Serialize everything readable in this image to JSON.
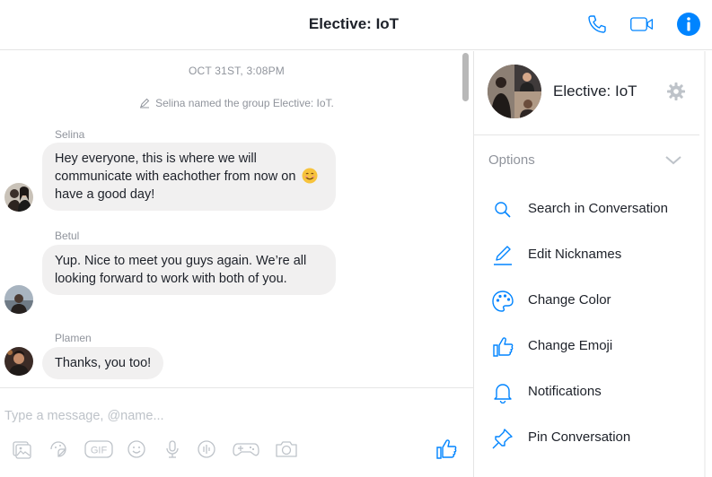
{
  "header": {
    "title": "Elective: IoT",
    "icons": [
      "phone-icon",
      "video-camera-icon",
      "info-icon"
    ],
    "accent_color": "#0084ff"
  },
  "chat": {
    "timestamp": "OCT 31ST, 3:08PM",
    "system_message": "Selina named the group Elective: IoT.",
    "messages": [
      {
        "sender": "Selina",
        "text": "Hey everyone, this is where we will communicate with eachother from now on",
        "text_after_emoji": "have a good day!",
        "emoji": "smiling-face-emoji"
      },
      {
        "sender": "Betul",
        "text": "Yup. Nice to meet you guys again. We’re all looking forward to work with both of you."
      },
      {
        "sender": "Plamen",
        "text": "Thanks, you too!"
      }
    ],
    "bubble_color": "#f1f0f0"
  },
  "composer": {
    "placeholder": "Type a message, @name...",
    "tools": [
      "image-icon",
      "sticker-icon",
      "gif-icon",
      "emoji-icon",
      "microphone-icon",
      "audio-clip-icon",
      "game-controller-icon",
      "camera-icon"
    ],
    "send_icon": "thumbs-up-icon"
  },
  "sidebar": {
    "group_name": "Elective: IoT",
    "options_label": "Options",
    "items": [
      {
        "label": "Search in Conversation",
        "icon": "search-icon"
      },
      {
        "label": "Edit Nicknames",
        "icon": "pencil-icon"
      },
      {
        "label": "Change Color",
        "icon": "palette-icon"
      },
      {
        "label": "Change Emoji",
        "icon": "thumbs-up-icon"
      },
      {
        "label": "Notifications",
        "icon": "bell-icon"
      },
      {
        "label": "Pin Conversation",
        "icon": "pin-icon"
      }
    ]
  }
}
